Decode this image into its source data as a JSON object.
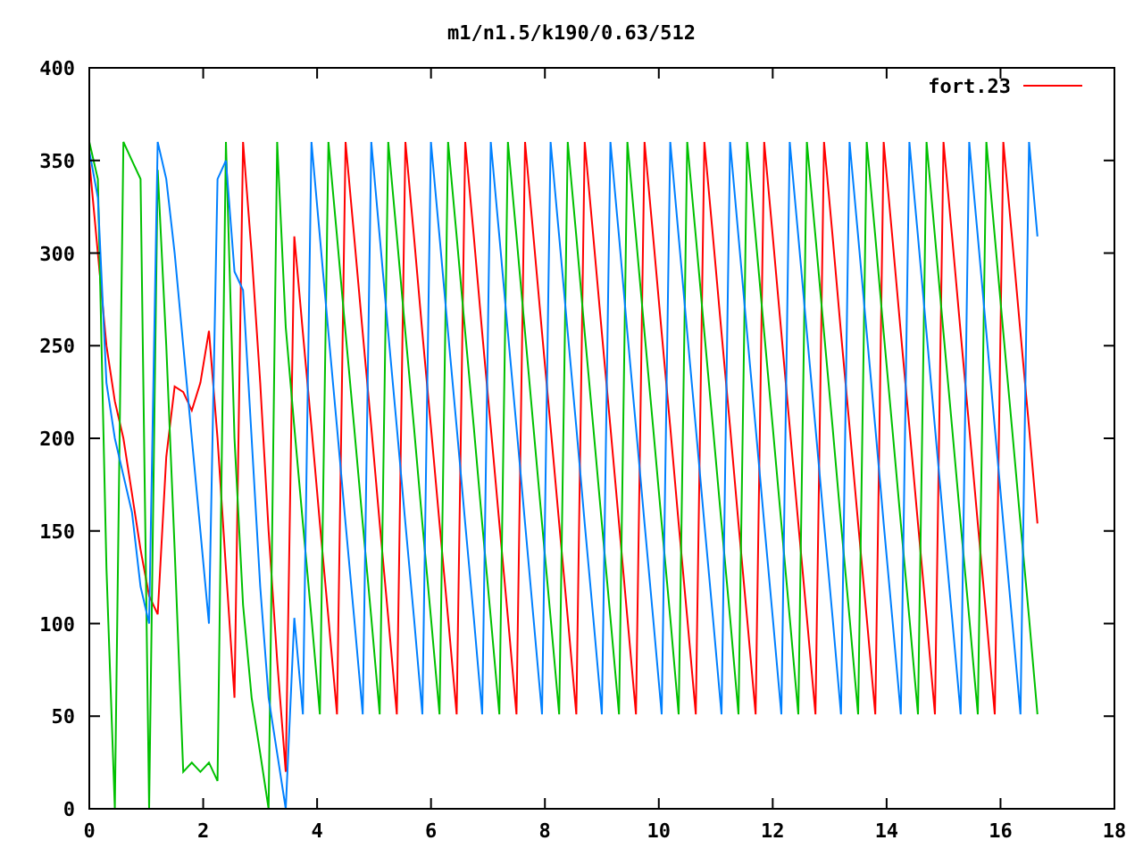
{
  "chart_data": {
    "type": "line",
    "title": "m1/n1.5/k190/0.63/512",
    "xlim": [
      0,
      18
    ],
    "ylim": [
      0,
      400
    ],
    "xticks": [
      0,
      2,
      4,
      6,
      8,
      10,
      12,
      14,
      16,
      18
    ],
    "yticks": [
      0,
      50,
      100,
      150,
      200,
      250,
      300,
      350,
      400
    ],
    "x": [
      0,
      0.15,
      0.3,
      0.45,
      0.6,
      0.75,
      0.9,
      1.05,
      1.2,
      1.35,
      1.5,
      1.65,
      1.8,
      1.95,
      2.1,
      2.25,
      2.4,
      2.55,
      2.7,
      2.85,
      3,
      3.15,
      3.3,
      3.45,
      3.6,
      3.75,
      3.9,
      4.05,
      4.2,
      4.35,
      4.5,
      4.65,
      4.8,
      4.95,
      5.1,
      5.25,
      5.4,
      5.55,
      5.7,
      5.85,
      6,
      6.15,
      6.3,
      6.45,
      6.6,
      6.75,
      6.9,
      7.05,
      7.2,
      7.35,
      7.5,
      7.65,
      7.8,
      7.95,
      8.1,
      8.25,
      8.4,
      8.55,
      8.7,
      8.85,
      9,
      9.15,
      9.3,
      9.45,
      9.6,
      9.75,
      9.9,
      10.05,
      10.2,
      10.35,
      10.5,
      10.65,
      10.8,
      10.95,
      11.1,
      11.25,
      11.4,
      11.55,
      11.7,
      11.85,
      12,
      12.15,
      12.3,
      12.45,
      12.6,
      12.75,
      12.9,
      13.05,
      13.2,
      13.35,
      13.5,
      13.65,
      13.8,
      13.95,
      14.1,
      14.25,
      14.4,
      14.55,
      14.7,
      14.85,
      15,
      15.15,
      15.3,
      15.45,
      15.6,
      15.75,
      15.9,
      16.05,
      16.2,
      16.35,
      16.5,
      16.65
    ],
    "series": [
      {
        "name": "fort.23",
        "color": "#ff0000",
        "values": [
          350,
          300,
          250,
          220,
          200,
          170,
          140,
          115,
          105,
          190,
          228,
          225,
          215,
          230,
          258,
          200,
          130,
          60,
          360,
          300,
          230,
          150,
          80,
          20,
          309,
          257,
          206,
          154,
          103,
          51,
          360,
          309,
          257,
          206,
          154,
          103,
          51,
          360,
          309,
          257,
          206,
          154,
          103,
          51,
          360,
          309,
          257,
          206,
          154,
          103,
          51,
          360,
          309,
          257,
          206,
          154,
          103,
          51,
          360,
          309,
          257,
          206,
          154,
          103,
          51,
          360,
          309,
          257,
          206,
          154,
          103,
          51,
          360,
          309,
          257,
          206,
          154,
          103,
          51,
          360,
          309,
          257,
          206,
          154,
          103,
          51,
          360,
          309,
          257,
          206,
          154,
          103,
          51,
          360,
          309,
          257,
          206,
          154,
          103,
          51,
          360,
          309,
          257,
          206,
          154,
          103,
          51,
          360,
          309,
          257,
          206,
          154
        ]
      },
      {
        "color": "#00c000",
        "values": [
          360,
          340,
          130,
          0,
          360,
          350,
          340,
          0,
          345,
          250,
          140,
          20,
          25,
          20,
          25,
          15,
          360,
          200,
          110,
          60,
          30,
          0,
          360,
          260,
          206,
          154,
          103,
          51,
          360,
          309,
          257,
          206,
          154,
          103,
          51,
          360,
          309,
          257,
          206,
          154,
          103,
          51,
          360,
          309,
          257,
          206,
          154,
          103,
          51,
          360,
          309,
          257,
          206,
          154,
          103,
          51,
          360,
          309,
          257,
          206,
          154,
          103,
          51,
          360,
          309,
          257,
          206,
          154,
          103,
          51,
          360,
          309,
          257,
          206,
          154,
          103,
          51,
          360,
          309,
          257,
          206,
          154,
          103,
          51,
          360,
          309,
          257,
          206,
          154,
          103,
          51,
          360,
          309,
          257,
          206,
          154,
          103,
          51,
          360,
          309,
          257,
          206,
          154,
          103,
          51,
          360,
          309,
          257,
          206,
          154,
          103,
          51
        ]
      },
      {
        "color": "#0080ff",
        "values": [
          355,
          330,
          230,
          200,
          180,
          160,
          120,
          100,
          360,
          340,
          300,
          250,
          200,
          150,
          100,
          340,
          350,
          290,
          280,
          200,
          120,
          60,
          30,
          0,
          103,
          51,
          360,
          309,
          257,
          206,
          154,
          103,
          51,
          360,
          309,
          257,
          206,
          154,
          103,
          51,
          360,
          309,
          257,
          206,
          154,
          103,
          51,
          360,
          309,
          257,
          206,
          154,
          103,
          51,
          360,
          309,
          257,
          206,
          154,
          103,
          51,
          360,
          309,
          257,
          206,
          154,
          103,
          51,
          360,
          309,
          257,
          206,
          154,
          103,
          51,
          360,
          309,
          257,
          206,
          154,
          103,
          51,
          360,
          309,
          257,
          206,
          154,
          103,
          51,
          360,
          309,
          257,
          206,
          154,
          103,
          51,
          360,
          309,
          257,
          206,
          154,
          103,
          51,
          360,
          309,
          257,
          206,
          154,
          103,
          51,
          360,
          309
        ]
      }
    ]
  }
}
